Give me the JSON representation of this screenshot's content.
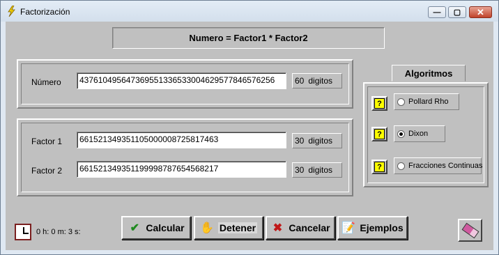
{
  "window": {
    "title": "Factorización"
  },
  "header": {
    "text": "Numero = Factor1 * Factor2"
  },
  "numero": {
    "label": "Número",
    "value": "437610495647369551336533004629577846576256",
    "digits_count": "60",
    "digits_unit": "digitos"
  },
  "factor1": {
    "label": "Factor 1",
    "value": "661521349351105000008725817463",
    "digits_count": "30",
    "digits_unit": "digitos"
  },
  "factor2": {
    "label": "Factor 2",
    "value": "661521349351199998787654568217",
    "digits_count": "30",
    "digits_unit": "digitos"
  },
  "algoritmos": {
    "title": "Algoritmos",
    "help_label": "?",
    "options": [
      {
        "label": "Pollard Rho",
        "selected": false
      },
      {
        "label": "Dixon",
        "selected": true
      },
      {
        "label": "Fracciones Continuas",
        "selected": false
      }
    ]
  },
  "buttons": {
    "calcular": "Calcular",
    "detener": "Detener",
    "cancelar": "Cancelar",
    "ejemplos": "Ejemplos"
  },
  "timer": {
    "text": "0 h: 0 m: 3 s:"
  },
  "icons": {
    "app": "lightning-icon",
    "calcular": "checkmark-icon",
    "detener": "hand-icon",
    "cancelar": "x-icon",
    "ejemplos": "notepad-icon",
    "timer": "clock-icon",
    "clear": "eraser-icon"
  },
  "colors": {
    "check_green": "#1f8a1f",
    "cancel_red": "#c01818",
    "help_yellow": "#ffff00",
    "face": "#c0c0c0"
  }
}
